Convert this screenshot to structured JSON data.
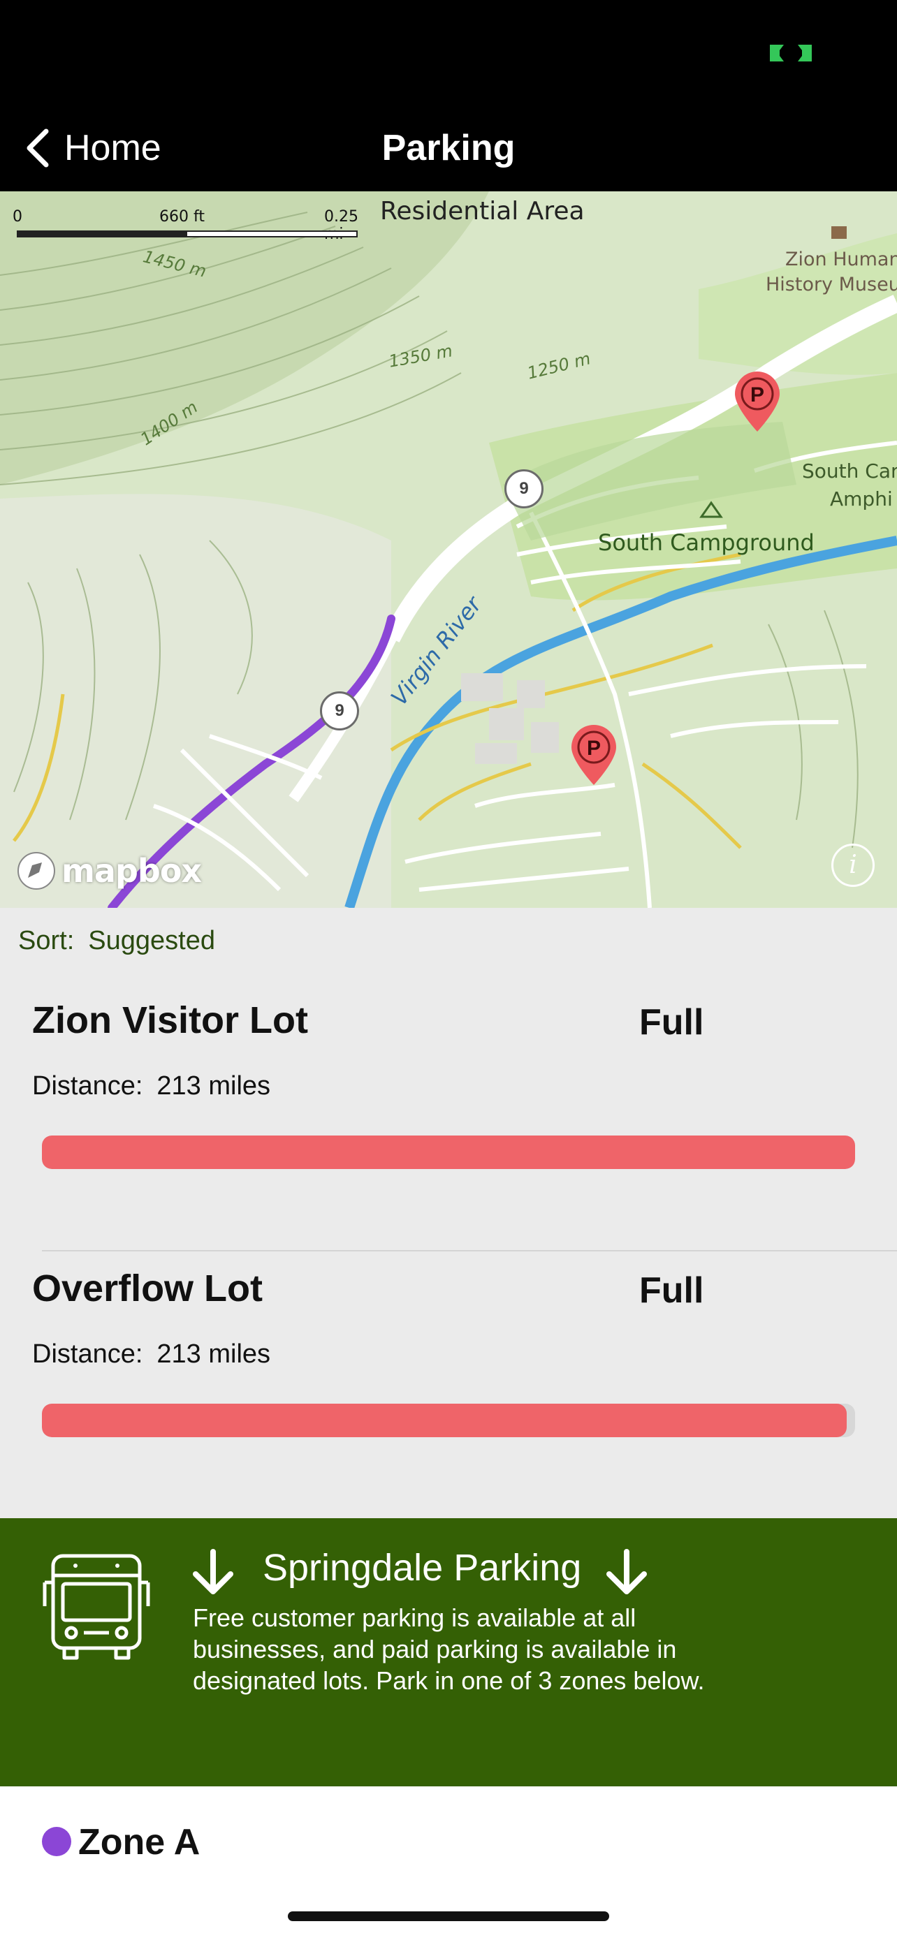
{
  "nav": {
    "back_label": "Home",
    "title": "Parking"
  },
  "map": {
    "scale": {
      "start": "0",
      "mid": "660 ft",
      "end": "0.25 mi"
    },
    "labels": {
      "residential": "Residential Area",
      "museum_line1": "Zion Human",
      "museum_line2": "History Museu",
      "amphi_line1": "South Can",
      "amphi_line2": "Amphi",
      "campground": "South Campground",
      "river": "Virgin River"
    },
    "contours": [
      "1450 m",
      "1350 m",
      "1250 m",
      "1400 m"
    ],
    "route_number": "9",
    "parking_pin_label": "P",
    "logo": "mapbox",
    "info_glyph": "i",
    "colors": {
      "route": "#8b46d6",
      "pin": "#ef5a5f",
      "river": "#4aa3df"
    }
  },
  "sort": {
    "label": "Sort:",
    "value": "Suggested"
  },
  "lots": [
    {
      "name": "Zion Visitor Lot",
      "status": "Full",
      "distance_label": "Distance:",
      "distance": "213 miles",
      "fill_percent": 100
    },
    {
      "name": "Overflow Lot",
      "status": "Full",
      "distance_label": "Distance:",
      "distance": "213 miles",
      "fill_percent": 99
    }
  ],
  "banner": {
    "title": "Springdale Parking",
    "description": "Free customer parking is available at all businesses, and paid parking is available in designated lots.  Park in one of 3 zones below.",
    "icon": "bus-icon",
    "color": "#346005"
  },
  "zone": {
    "label": "Zone A",
    "color": "#8b46d6"
  },
  "status_bar": {
    "battery_color": "#34c759"
  }
}
